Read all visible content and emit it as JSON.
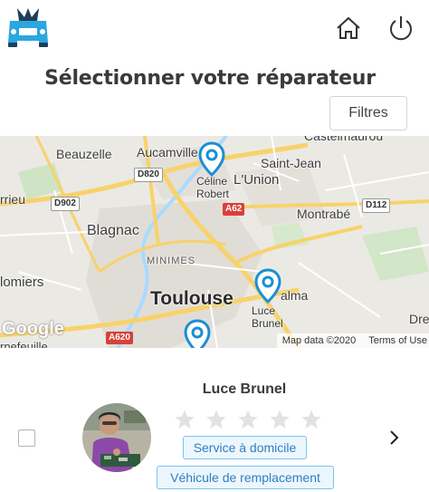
{
  "header": {
    "logo_icon": "car-repair-logo-icon",
    "home_icon": "home-icon",
    "power_icon": "power-icon"
  },
  "page": {
    "title": "Sélectionner votre réparateur",
    "filters_label": "Filtres"
  },
  "map": {
    "places": {
      "beauzelle": "Beauzelle",
      "aucamville": "Aucamville",
      "saint_jean": "Saint-Jean",
      "lunion": "L'Union",
      "blagnac": "Blagnac",
      "montrabe": "Montrabé",
      "minimes": "MINIMES",
      "toulouse": "Toulouse",
      "colomiers": "lomiers",
      "parrieu": "rrieu",
      "castelmaurou": "Castelmaurou",
      "balma": "alma",
      "dremil": "Dre",
      "tournefeuille": "rnefeuille"
    },
    "roads": {
      "d820": "D820",
      "d902": "D902",
      "a62": "A62",
      "d112": "D112",
      "a620": "A620"
    },
    "pins": [
      {
        "label_line1": "Céline",
        "label_line2": "Robert"
      },
      {
        "label_line1": "Luce",
        "label_line2": "Brunel"
      },
      {
        "label_line1": "",
        "label_line2": ""
      }
    ],
    "google_label": "Google",
    "attribution": "Map data ©2020",
    "terms": "Terms of Use"
  },
  "repairer": {
    "name": "Luce Brunel",
    "rating": 0,
    "rating_max": 5,
    "tags": [
      "Service à domicile",
      "Véhicule de remplacement"
    ],
    "checked": false,
    "next_icon": "chevron-right-icon"
  },
  "colors": {
    "logo_blue": "#2aa6e0",
    "pin_blue": "#1a8fd4",
    "tag_border": "#7ac4ee",
    "tag_text": "#2f7fc1",
    "star_empty": "#e2e2e2"
  }
}
